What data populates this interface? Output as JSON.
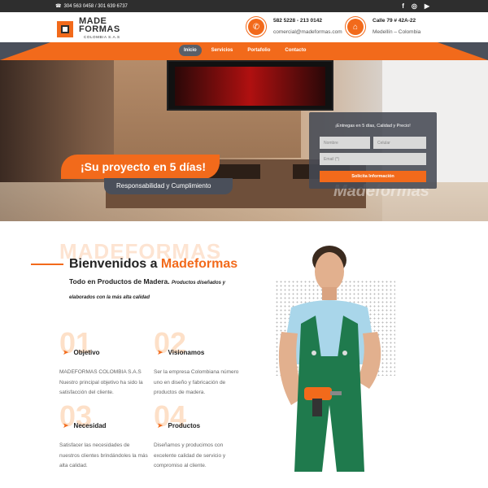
{
  "topbar": {
    "phone_icon": "phone-icon",
    "phones": "304 563 0458 / 301 639 6737",
    "socials": [
      "facebook-icon",
      "instagram-icon",
      "youtube-icon"
    ]
  },
  "header": {
    "logo_line1": "MADE",
    "logo_line2": "FORMAS",
    "logo_sub": "COLOMBIA S.A.S",
    "contact1_line1": "582 5228 - 213 0142",
    "contact1_line2": "comercial@madeformas.com",
    "contact2_line1": "Calle 79 # 42A-22",
    "contact2_line2": "Medellín – Colombia"
  },
  "nav": {
    "items": [
      "Inicio",
      "Servicios",
      "Portafolio",
      "Contacto"
    ],
    "active": "Inicio"
  },
  "hero": {
    "slogan": "¡Su proyecto en 5 días!",
    "subslogan": "Responsabilidad y Cumplimiento",
    "form_title": "¡Entregas en 5 días, Calidad y Precio!",
    "name_placeholder": "Nombre",
    "phone_placeholder": "Celular",
    "email_placeholder": "Email (*)",
    "submit_label": "Solicita Información",
    "watermark": "Madeformas"
  },
  "main": {
    "ghost_title": "MADEFORMAS",
    "welcome_prefix": "Bienvenidos a ",
    "welcome_highlight": "Madeformas",
    "intro_bold": "Todo en Productos de Madera.",
    "intro_small": "Productos diseñados y elaborados con la más alta calidad",
    "features": [
      {
        "num": "01",
        "title": "Objetivo",
        "desc": "MADEFORMAS COLOMBIA S.A.S Nuestro principal objetivo ha sido la satisfacción del cliente."
      },
      {
        "num": "02",
        "title": "Visionamos",
        "desc": "Ser la empresa Colombiana número uno en diseño y fabricación de productos de madera."
      },
      {
        "num": "03",
        "title": "Necesidad",
        "desc": "Satisfacer las necesidades de nuestros clientes brindándoles la más alta calidad."
      },
      {
        "num": "04",
        "title": "Productos",
        "desc": "Diseñamos y producimos con excelente calidad de servicio y compromiso al cliente."
      }
    ]
  },
  "colors": {
    "accent": "#f26a1b",
    "dark": "#2e2e2e",
    "slate": "#4a4f5a"
  }
}
